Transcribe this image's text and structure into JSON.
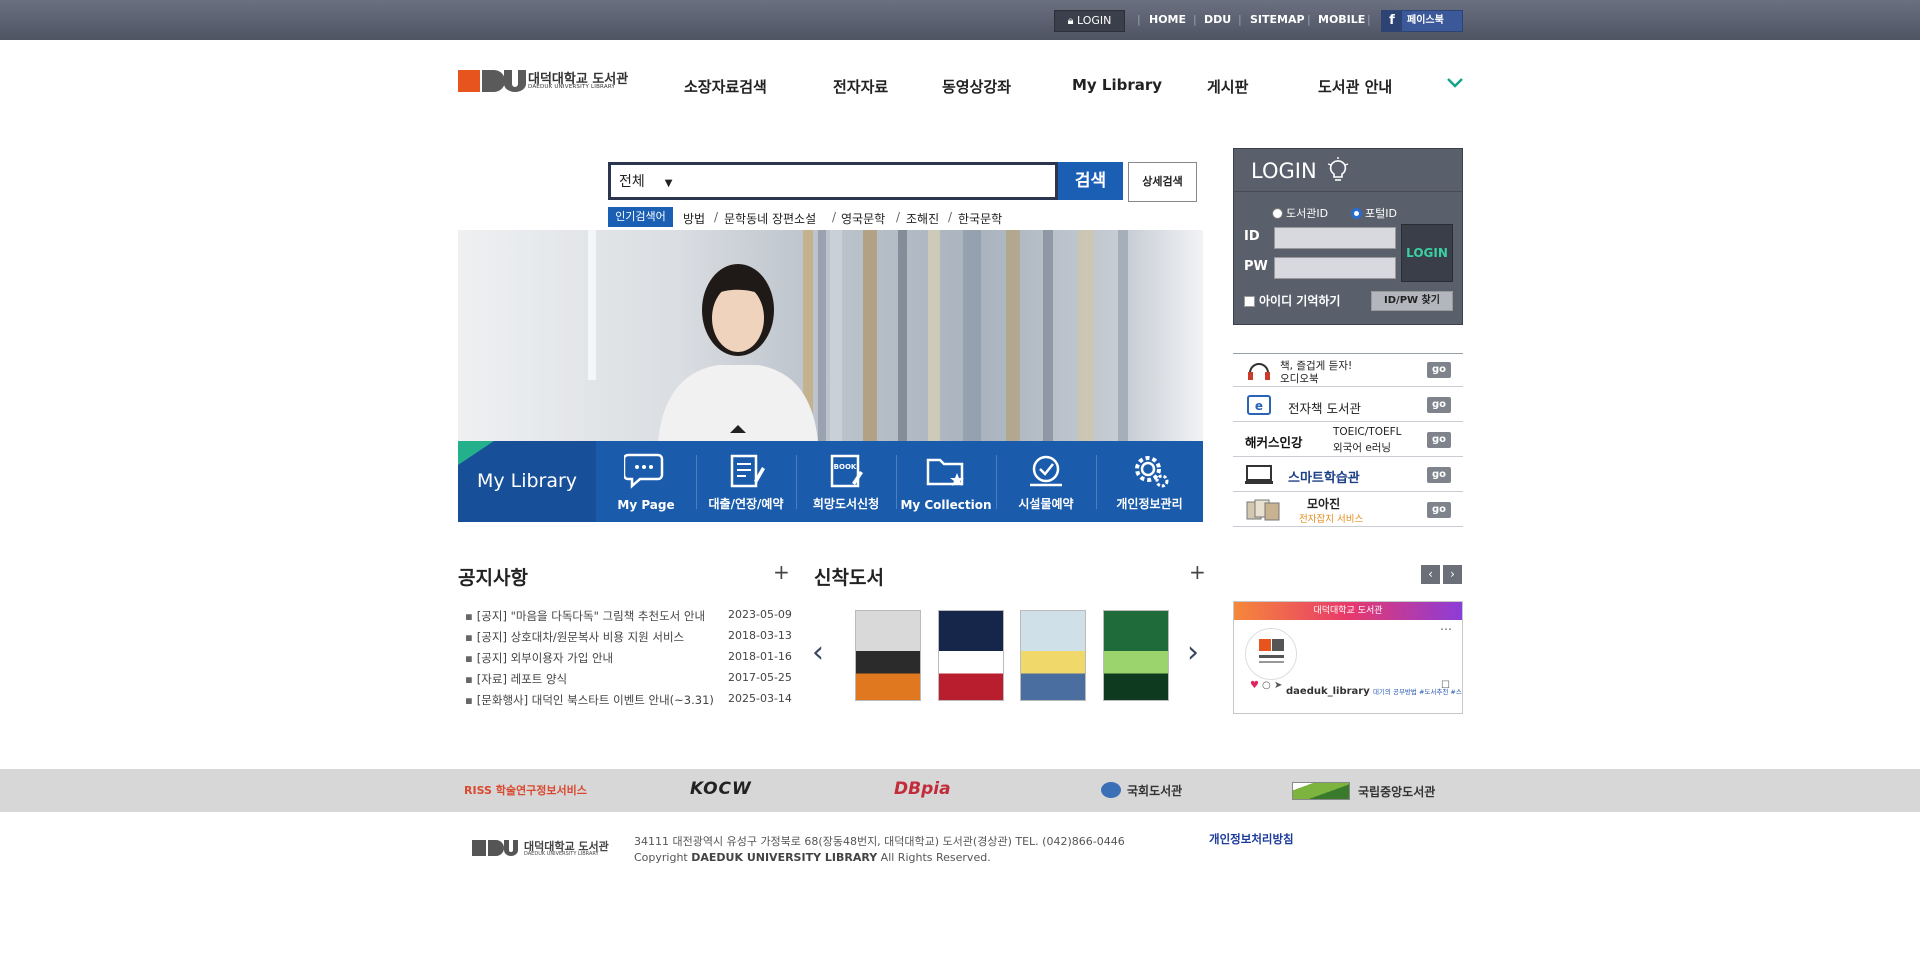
{
  "topbar": {
    "login_label": "LOGIN",
    "links": [
      "HOME",
      "DDU",
      "SITEMAP",
      "MOBILE"
    ],
    "facebook_label": "페이스북"
  },
  "logo": {
    "name_ko": "대덕대학교 도서관",
    "name_en": "DAEDUK UNIVERSITY LIBRARY",
    "brand_color": "#e8541d"
  },
  "gnb": {
    "items": [
      "소장자료검색",
      "전자자료",
      "동영상강좌",
      "My Library",
      "게시판",
      "도서관 안내"
    ],
    "chevron_icon": "chevron-down-icon",
    "chevron_color": "#14a38a"
  },
  "search": {
    "scope_value": "전체",
    "search_button": "검색",
    "advanced_button": "상세검색",
    "popular_label": "인기검색어",
    "popular_keywords": [
      "방법",
      "문학동네 장편소설",
      "영국문학",
      "조해진",
      "한국문학"
    ]
  },
  "my_library": {
    "title": "My Library",
    "items": [
      {
        "label": "My Page",
        "icon": "chat-bubble-icon"
      },
      {
        "label": "대출/연장/예약",
        "icon": "notepad-icon"
      },
      {
        "label": "희망도서신청",
        "icon": "book-request-icon"
      },
      {
        "label": "My Collection",
        "icon": "folder-star-icon"
      },
      {
        "label": "시설물예약",
        "icon": "reservation-icon"
      },
      {
        "label": "개인정보관리",
        "icon": "gear-icon"
      }
    ],
    "accent_color": "#1a5bab"
  },
  "login": {
    "title": "LOGIN",
    "radio_library": "도서관ID",
    "radio_portal": "포털ID",
    "id_label": "ID",
    "pw_label": "PW",
    "login_button": "LOGIN",
    "remember_label": "아이디 기억하기",
    "find_button": "ID/PW 찾기"
  },
  "quick_links": [
    {
      "line1": "책, 즐겁게 듣자!",
      "line2": "오디오북",
      "icon": "headphones-icon",
      "go": "go"
    },
    {
      "line1": "전자책 도서관",
      "line2": "",
      "icon": "ebook-icon",
      "go": "go"
    },
    {
      "brand": "해커스인강",
      "line1": "TOEIC/TOEFL",
      "line2": "외국어 e러닝",
      "icon": "hackers-logo-icon",
      "go": "go"
    },
    {
      "brand": "스마트학습관",
      "line1": "",
      "line2": "",
      "icon": "monitor-icon",
      "go": "go"
    },
    {
      "brand": "모아진",
      "line1": "전자잡지 서비스",
      "line2": "",
      "icon": "magazine-icon",
      "go": "go"
    }
  ],
  "notices": {
    "title": "공지사항",
    "more": "+",
    "items": [
      {
        "title": "[공지] \"마음을 다독다독\" 그림책 추천도서 안내",
        "date": "2023-05-09"
      },
      {
        "title": "[공지] 상호대차/원문복사 비용 지원 서비스",
        "date": "2018-03-13"
      },
      {
        "title": "[공지] 외부이용자 가입 안내",
        "date": "2018-01-16"
      },
      {
        "title": "[자료] 레포트 양식",
        "date": "2017-05-25"
      },
      {
        "title": "[문화행사] 대덕인 북스타트 이벤트 안내(~3.31)",
        "date": "2025-03-14"
      }
    ]
  },
  "new_books": {
    "title": "신착도서",
    "more": "+",
    "covers": [
      {
        "colors": [
          "#d9d9d9",
          "#2b2b2b",
          "#e0781f"
        ]
      },
      {
        "colors": [
          "#16264a",
          "#ffffff",
          "#b91e2f"
        ]
      },
      {
        "colors": [
          "#cfe0e8",
          "#f1d86a",
          "#4a6ea0"
        ]
      },
      {
        "colors": [
          "#1f6b3a",
          "#9bd36c",
          "#0e3a1f"
        ]
      }
    ]
  },
  "instagram": {
    "header": "대덕대학교 도서관",
    "account": "daeduk_library",
    "caption": "대기의 공부방법 #도서추천 #스트레칭루틴 #도서관 #Y노트에도 #하루도서관"
  },
  "partners": [
    {
      "name": "RISS 학술연구정보서비스",
      "color": "#d9492f"
    },
    {
      "name": "KOCW",
      "color": "#222222"
    },
    {
      "name": "DBpia",
      "color": "#c22c3a"
    },
    {
      "name": "국회도서관",
      "color": "#333333"
    },
    {
      "name": "국립중앙도서관",
      "color": "#333333"
    }
  ],
  "footer": {
    "address": "34111 대전광역시 유성구 가정북로 68(장동48번지, 대덕대학교) 도서관(경상관) TEL. (042)866-0446",
    "copyright_prefix": "Copyright",
    "copyright_name": "DAEDUK UNIVERSITY LIBRARY",
    "copyright_suffix": "All Rights Reserved.",
    "privacy": "개인정보처리방침"
  }
}
